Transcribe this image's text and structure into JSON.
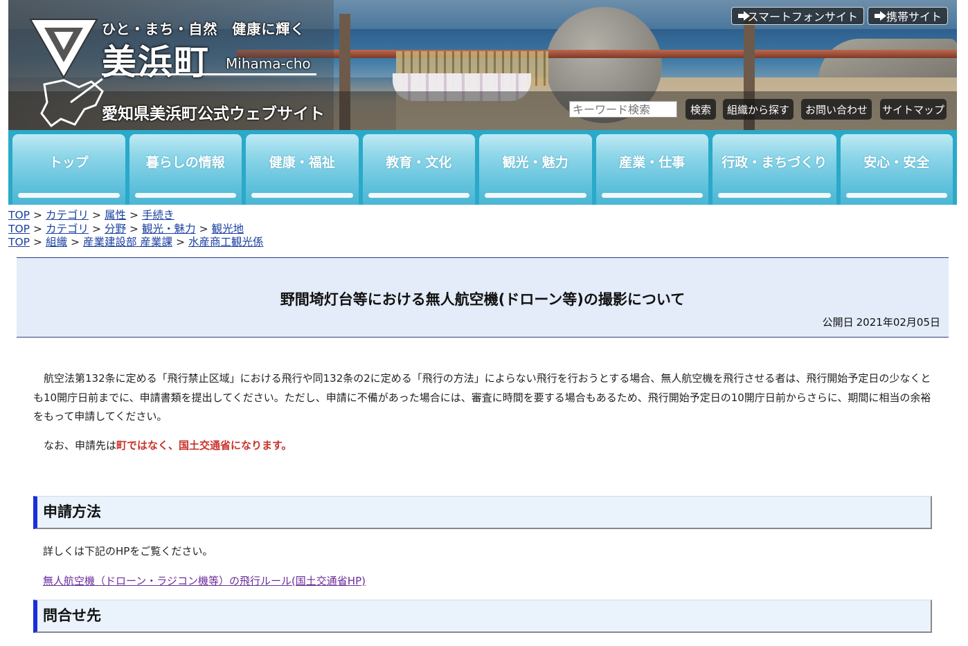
{
  "header": {
    "tagline": "ひと・まち・自然　健康に輝く",
    "town_name": "美浜町",
    "town_roman": "Mihama-cho",
    "site_title": "愛知県美浜町公式ウェブサイト",
    "smartphone_label": "スマートフォンサイト",
    "mobile_label": "携帯サイト",
    "search_placeholder": "キーワード検索",
    "search_button": "検索",
    "org_search": "組織から探す",
    "contact": "お問い合わせ",
    "sitemap": "サイトマップ"
  },
  "nav": [
    "トップ",
    "暮らしの情報",
    "健康・福祉",
    "教育・文化",
    "観光・魅力",
    "産業・仕事",
    "行政・まちづくり",
    "安心・安全"
  ],
  "breadcrumbs": [
    [
      "TOP",
      "カテゴリ",
      "属性",
      "手続き"
    ],
    [
      "TOP",
      "カテゴリ",
      "分野",
      "観光・魅力",
      "観光地"
    ],
    [
      "TOP",
      "組織",
      "産業建設部 産業課",
      "水産商工観光係"
    ]
  ],
  "breadcrumb_separator": ">",
  "page": {
    "title": "野間埼灯台等における無人航空機(ドローン等)の撮影について",
    "date_label": "公開日",
    "date_value": "2021年02月05日",
    "intro": "航空法第132条に定める「飛行禁止区域」における飛行や同132条の2に定める「飛行の方法」によらない飛行を行おうとする場合、無人航空機を飛行させる者は、飛行開始予定日の少なくとも10開庁日前までに、申請書類を提出してください。ただし、申請に不備があった場合には、審査に時間を要する場合もあるため、飛行開始予定日の10開庁日前からさらに、期間に相当の余裕をもって申請してください。",
    "note_prefix": "なお、申請先は",
    "note_emphasis": "町ではなく、国土交通省になります。",
    "section_method": "申請方法",
    "method_text": "詳しくは下記のHPをご覧ください。",
    "method_link": "無人航空機（ドローン・ラジコン機等）の飛行ルール(国土交通省HP)",
    "section_contact": "問合せ先"
  },
  "colors": {
    "nav_bg": "#2aa9c9",
    "title_bg": "#e3ecf8",
    "section_accent": "#1a2fd8",
    "emphasis_red": "#c8322a",
    "link_blue": "#1a3fa0",
    "visited_link": "#6a2c9a"
  }
}
